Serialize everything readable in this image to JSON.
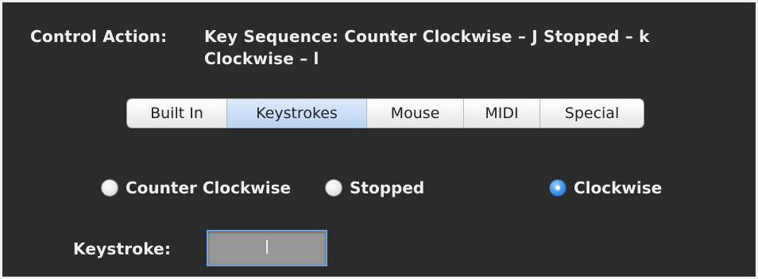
{
  "control_action": {
    "label": "Control Action:",
    "value_line1": "Key Sequence:  Counter Clockwise – J  Stopped – k",
    "value_line2": "Clockwise – l"
  },
  "tabs": [
    {
      "label": "Built In",
      "selected": false
    },
    {
      "label": "Keystrokes",
      "selected": true
    },
    {
      "label": "Mouse",
      "selected": false
    },
    {
      "label": "MIDI",
      "selected": false
    },
    {
      "label": "Special",
      "selected": false
    }
  ],
  "direction_options": [
    {
      "label": "Counter Clockwise",
      "selected": false
    },
    {
      "label": "Stopped",
      "selected": false
    },
    {
      "label": "Clockwise",
      "selected": true
    }
  ],
  "keystroke": {
    "label": "Keystroke:",
    "value": "l"
  },
  "colors": {
    "panel_background": "#2b2b2b",
    "text": "#efefef",
    "selected_tab": "#b9d3f3",
    "radio_selected": "#3f93e6",
    "field_background": "#979797",
    "field_focus_border": "#73a3da"
  }
}
